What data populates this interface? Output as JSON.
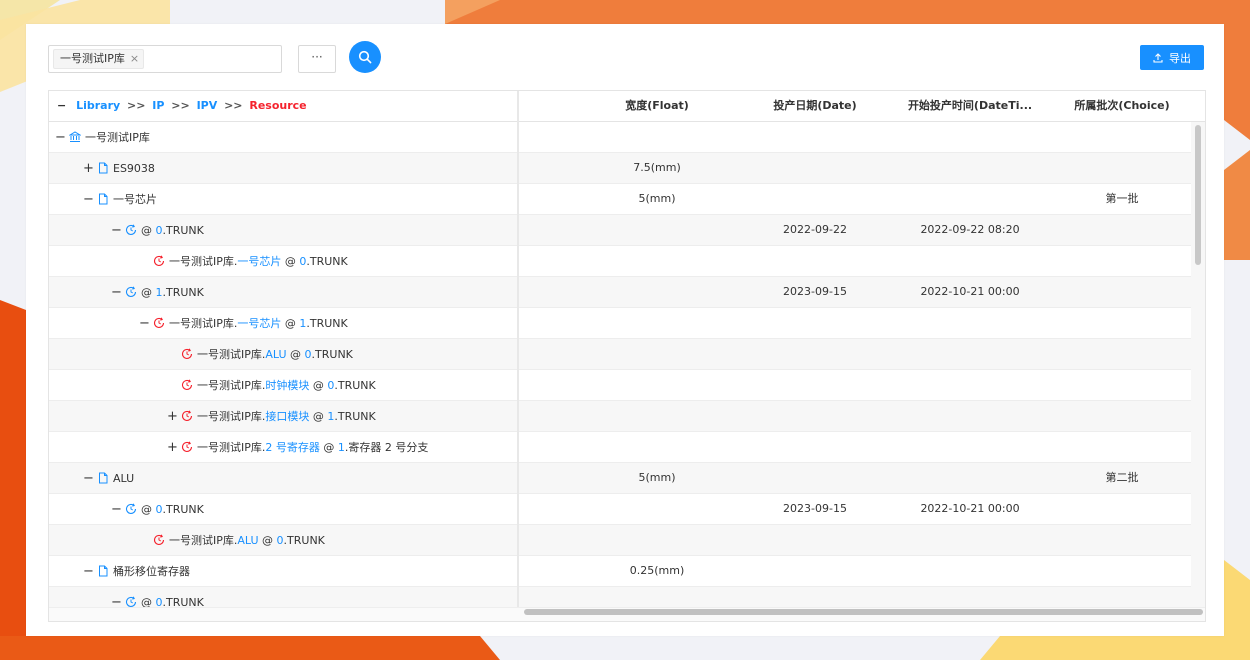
{
  "toolbar": {
    "selected_tag": "一号测试IP库",
    "tag_remove_glyph": "×",
    "more_label": "···",
    "export_label": "导出"
  },
  "breadcrumb": {
    "collapse_glyph": "−",
    "items": [
      "Library",
      "IP",
      "IPV",
      "Resource"
    ],
    "separator": ">>"
  },
  "columns": [
    "宽度(Float)",
    "投产日期(Date)",
    "开始投产时间(DateTi...",
    "所属批次(Choice)"
  ],
  "rows": [
    {
      "level": 0,
      "expander": "−",
      "icon": "library-icon",
      "parts": [
        {
          "t": "一号测试IP库"
        }
      ],
      "c1": "",
      "c2": "",
      "c3": "",
      "c4": ""
    },
    {
      "level": 1,
      "expander": "+",
      "icon": "file-icon",
      "parts": [
        {
          "t": "ES9038"
        }
      ],
      "c1": "7.5(mm)",
      "c2": "",
      "c3": "",
      "c4": ""
    },
    {
      "level": 1,
      "expander": "−",
      "icon": "file-icon",
      "parts": [
        {
          "t": "一号芯片"
        }
      ],
      "c1": "5(mm)",
      "c2": "",
      "c3": "",
      "c4": "第一批"
    },
    {
      "level": 2,
      "expander": "−",
      "icon": "version-icon",
      "parts": [
        {
          "t": "@ "
        },
        {
          "t": "0",
          "b": true
        },
        {
          "t": ".TRUNK"
        }
      ],
      "c1": "",
      "c2": "2022-09-22",
      "c3": "2022-09-22 08:20",
      "c4": ""
    },
    {
      "level": 3,
      "expander": "",
      "icon": "reference-icon",
      "parts": [
        {
          "t": "一号测试IP库."
        },
        {
          "t": "一号芯片",
          "b": true
        },
        {
          "t": " @ "
        },
        {
          "t": "0",
          "b": true
        },
        {
          "t": ".TRUNK"
        }
      ],
      "c1": "",
      "c2": "",
      "c3": "",
      "c4": ""
    },
    {
      "level": 2,
      "expander": "−",
      "icon": "version-icon",
      "parts": [
        {
          "t": "@ "
        },
        {
          "t": "1",
          "b": true
        },
        {
          "t": ".TRUNK"
        }
      ],
      "c1": "",
      "c2": "2023-09-15",
      "c3": "2022-10-21 00:00",
      "c4": ""
    },
    {
      "level": 3,
      "expander": "−",
      "icon": "reference-icon",
      "parts": [
        {
          "t": "一号测试IP库."
        },
        {
          "t": "一号芯片",
          "b": true
        },
        {
          "t": " @ "
        },
        {
          "t": "1",
          "b": true
        },
        {
          "t": ".TRUNK"
        }
      ],
      "c1": "",
      "c2": "",
      "c3": "",
      "c4": ""
    },
    {
      "level": 4,
      "expander": "",
      "icon": "reference-icon",
      "parts": [
        {
          "t": "一号测试IP库."
        },
        {
          "t": "ALU",
          "b": true
        },
        {
          "t": " @ "
        },
        {
          "t": "0",
          "b": true
        },
        {
          "t": ".TRUNK"
        }
      ],
      "c1": "",
      "c2": "",
      "c3": "",
      "c4": ""
    },
    {
      "level": 4,
      "expander": "",
      "icon": "reference-icon",
      "parts": [
        {
          "t": "一号测试IP库."
        },
        {
          "t": "时钟模块",
          "b": true
        },
        {
          "t": " @ "
        },
        {
          "t": "0",
          "b": true
        },
        {
          "t": ".TRUNK"
        }
      ],
      "c1": "",
      "c2": "",
      "c3": "",
      "c4": ""
    },
    {
      "level": 4,
      "expander": "+",
      "icon": "reference-icon",
      "parts": [
        {
          "t": "一号测试IP库."
        },
        {
          "t": "接口模块",
          "b": true
        },
        {
          "t": " @ "
        },
        {
          "t": "1",
          "b": true
        },
        {
          "t": ".TRUNK"
        }
      ],
      "c1": "",
      "c2": "",
      "c3": "",
      "c4": ""
    },
    {
      "level": 4,
      "expander": "+",
      "icon": "reference-icon",
      "parts": [
        {
          "t": "一号测试IP库."
        },
        {
          "t": "2 号寄存器",
          "b": true
        },
        {
          "t": " @ "
        },
        {
          "t": "1",
          "b": true
        },
        {
          "t": ".寄存器 2 号分支"
        }
      ],
      "c1": "",
      "c2": "",
      "c3": "",
      "c4": ""
    },
    {
      "level": 1,
      "expander": "−",
      "icon": "file-icon",
      "parts": [
        {
          "t": "ALU"
        }
      ],
      "c1": "5(mm)",
      "c2": "",
      "c3": "",
      "c4": "第二批"
    },
    {
      "level": 2,
      "expander": "−",
      "icon": "version-icon",
      "parts": [
        {
          "t": "@ "
        },
        {
          "t": "0",
          "b": true
        },
        {
          "t": ".TRUNK"
        }
      ],
      "c1": "",
      "c2": "2023-09-15",
      "c3": "2022-10-21 00:00",
      "c4": ""
    },
    {
      "level": 3,
      "expander": "",
      "icon": "reference-icon",
      "parts": [
        {
          "t": "一号测试IP库."
        },
        {
          "t": "ALU",
          "b": true
        },
        {
          "t": " @ "
        },
        {
          "t": "0",
          "b": true
        },
        {
          "t": ".TRUNK"
        }
      ],
      "c1": "",
      "c2": "",
      "c3": "",
      "c4": ""
    },
    {
      "level": 1,
      "expander": "−",
      "icon": "file-icon",
      "parts": [
        {
          "t": "桶形移位寄存器"
        }
      ],
      "c1": "0.25(mm)",
      "c2": "",
      "c3": "",
      "c4": ""
    },
    {
      "level": 2,
      "expander": "−",
      "icon": "version-icon",
      "parts": [
        {
          "t": "@ "
        },
        {
          "t": "0",
          "b": true
        },
        {
          "t": ".TRUNK"
        }
      ],
      "c1": "",
      "c2": "",
      "c3": "",
      "c4": ""
    }
  ]
}
